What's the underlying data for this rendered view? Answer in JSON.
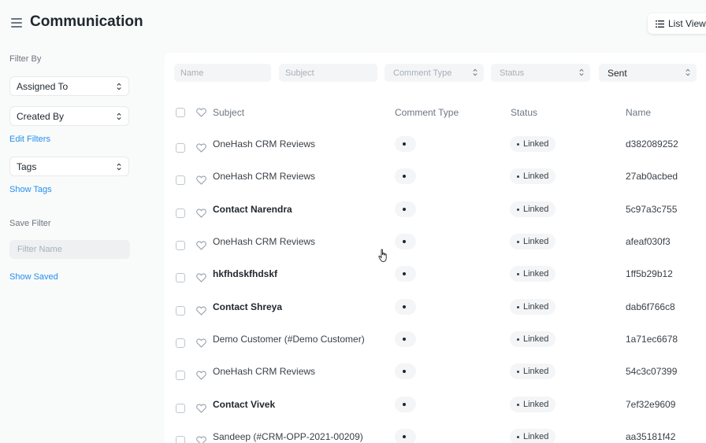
{
  "header": {
    "title": "Communication",
    "list_view_label": "List View"
  },
  "sidebar": {
    "filter_by_label": "Filter By",
    "assigned_to": "Assigned To",
    "created_by": "Created By",
    "edit_filters": "Edit Filters",
    "tags": "Tags",
    "show_tags": "Show Tags",
    "save_filter_label": "Save Filter",
    "filter_name_placeholder": "Filter Name",
    "show_saved": "Show Saved"
  },
  "filters": {
    "name_placeholder": "Name",
    "subject_placeholder": "Subject",
    "comment_type": "Comment Type",
    "status": "Status",
    "sent": "Sent"
  },
  "table": {
    "headers": {
      "subject": "Subject",
      "comment_type": "Comment Type",
      "status": "Status",
      "name": "Name"
    },
    "rows": [
      {
        "subject": "OneHash CRM Reviews",
        "bold": false,
        "status": "Linked",
        "name": "d382089252"
      },
      {
        "subject": "OneHash CRM Reviews",
        "bold": false,
        "status": "Linked",
        "name": "27ab0acbed"
      },
      {
        "subject": "Contact Narendra",
        "bold": true,
        "status": "Linked",
        "name": "5c97a3c755"
      },
      {
        "subject": "OneHash CRM Reviews",
        "bold": false,
        "status": "Linked",
        "name": "afeaf030f3"
      },
      {
        "subject": "hkfhdskfhdskf",
        "bold": true,
        "status": "Linked",
        "name": "1ff5b29b12"
      },
      {
        "subject": "Contact Shreya",
        "bold": true,
        "status": "Linked",
        "name": "dab6f766c8"
      },
      {
        "subject": "Demo Customer (#Demo Customer)",
        "bold": false,
        "status": "Linked",
        "name": "1a71ec6678"
      },
      {
        "subject": "OneHash CRM Reviews",
        "bold": false,
        "status": "Linked",
        "name": "54c3c07399"
      },
      {
        "subject": "Contact Vivek",
        "bold": true,
        "status": "Linked",
        "name": "7ef32e9609"
      },
      {
        "subject": "Sandeep (#CRM-OPP-2021-00209)",
        "bold": false,
        "status": "Linked",
        "name": "aa35181f42"
      }
    ]
  },
  "colors": {
    "accent_link": "#2490ef",
    "page_bg": "#f9fafa",
    "panel_bg": "#ffffff"
  },
  "icons": {
    "menu": "menu-icon",
    "list": "list-icon",
    "select_caret": "chevron-up-down-icon",
    "like": "heart-icon",
    "cursor": "hand-pointer-icon"
  }
}
